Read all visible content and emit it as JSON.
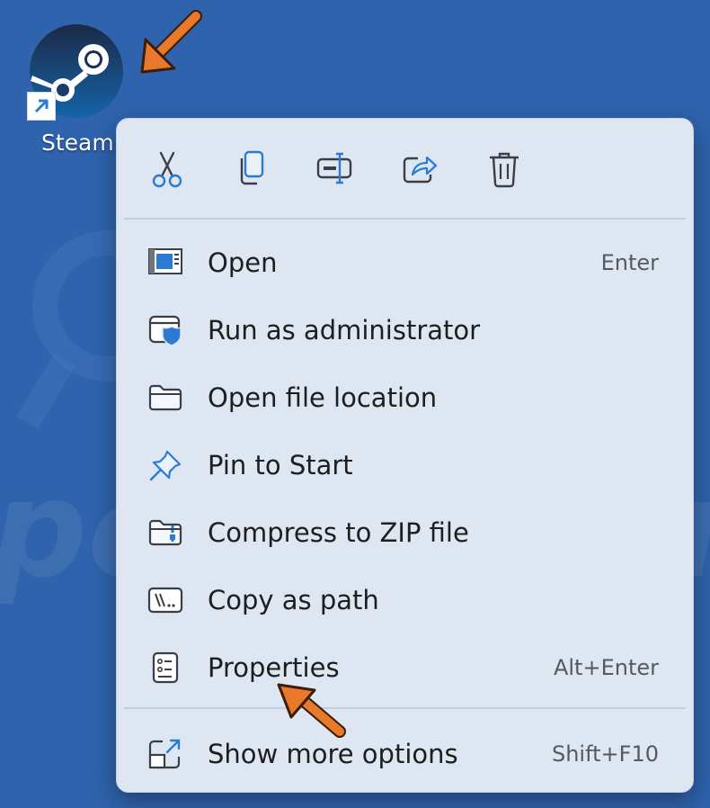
{
  "desktop": {
    "background_color": "#2f63ad",
    "shortcut": {
      "label": "Steam",
      "icon": "steam-logo-icon"
    },
    "watermark_text": "pcrisk.com"
  },
  "context_menu": {
    "quick_actions": [
      {
        "name": "cut",
        "icon": "scissors-icon"
      },
      {
        "name": "copy",
        "icon": "copy-icon"
      },
      {
        "name": "rename",
        "icon": "rename-icon"
      },
      {
        "name": "share",
        "icon": "share-icon"
      },
      {
        "name": "delete",
        "icon": "trash-icon"
      }
    ],
    "items": [
      {
        "label": "Open",
        "shortcut": "Enter",
        "icon": "open-window-icon"
      },
      {
        "label": "Run as administrator",
        "shortcut": "",
        "icon": "admin-shield-icon"
      },
      {
        "label": "Open file location",
        "shortcut": "",
        "icon": "folder-icon"
      },
      {
        "label": "Pin to Start",
        "shortcut": "",
        "icon": "pin-icon"
      },
      {
        "label": "Compress to ZIP file",
        "shortcut": "",
        "icon": "zip-folder-icon"
      },
      {
        "label": "Copy as path",
        "shortcut": "",
        "icon": "copy-path-icon"
      },
      {
        "label": "Properties",
        "shortcut": "Alt+Enter",
        "icon": "properties-icon"
      },
      {
        "label": "Show more options",
        "shortcut": "Shift+F10",
        "icon": "expand-icon"
      }
    ],
    "accent_color": "#2b7bd3"
  },
  "annotations": {
    "arrow_color": "#e8782a"
  }
}
